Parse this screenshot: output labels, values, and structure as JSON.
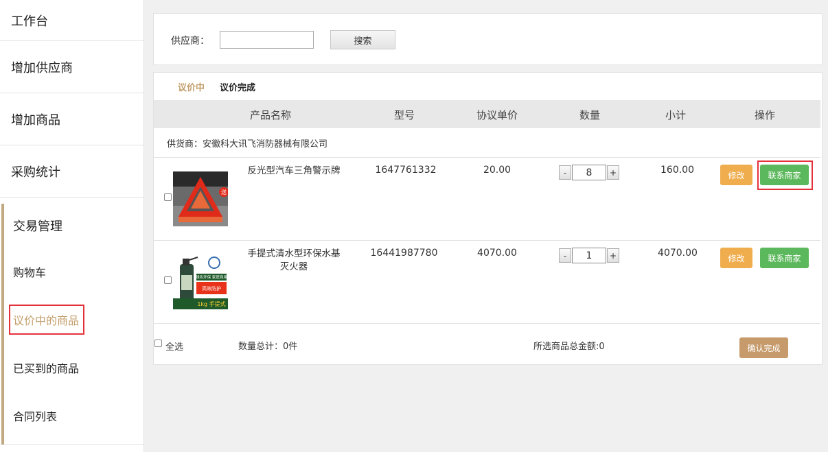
{
  "sidebar": {
    "top_items": [
      "工作台",
      "增加供应商",
      "增加商品",
      "采购统计"
    ],
    "group_title": "交易管理",
    "sub_items": [
      "购物车",
      "议价中的商品",
      "已买到的商品",
      "合同列表"
    ]
  },
  "search": {
    "label": "供应商：",
    "input_value": "",
    "button": "搜索"
  },
  "tabs": [
    "议价中",
    "议价完成"
  ],
  "table": {
    "headers": [
      "产品名称",
      "型号",
      "协议单价",
      "数量",
      "小计",
      "操作"
    ],
    "supplier": "供货商：安徽科大讯飞消防器械有限公司",
    "rows": [
      {
        "name": "反光型汽车三角警示牌",
        "model": "1647761332",
        "price": "20.00",
        "qty": "8",
        "subtotal": "160.00",
        "edit": "修改",
        "contact": "联系商家",
        "image_badge": "送"
      },
      {
        "name": "手提式清水型环保水基灭火器",
        "model": "16441987780",
        "price": "4070.00",
        "qty": "1",
        "subtotal": "4070.00",
        "edit": "修改",
        "contact": "联系商家",
        "image_label": "1kg 手提式",
        "image_tag1": "绿色环保 家庭商用",
        "image_tag2": "高效防护"
      }
    ],
    "qty_minus": "-",
    "qty_plus": "+"
  },
  "footer": {
    "select_all": "全选",
    "qty_total": "数量总计：0件",
    "amount_total": "所选商品总金额:0",
    "confirm": "确认完成"
  },
  "colors": {
    "accent": "#c29e6a",
    "edit": "#f0ad4e",
    "contact": "#5cb85c",
    "confirm": "#c69a6a",
    "highlight": "#e4323a"
  }
}
